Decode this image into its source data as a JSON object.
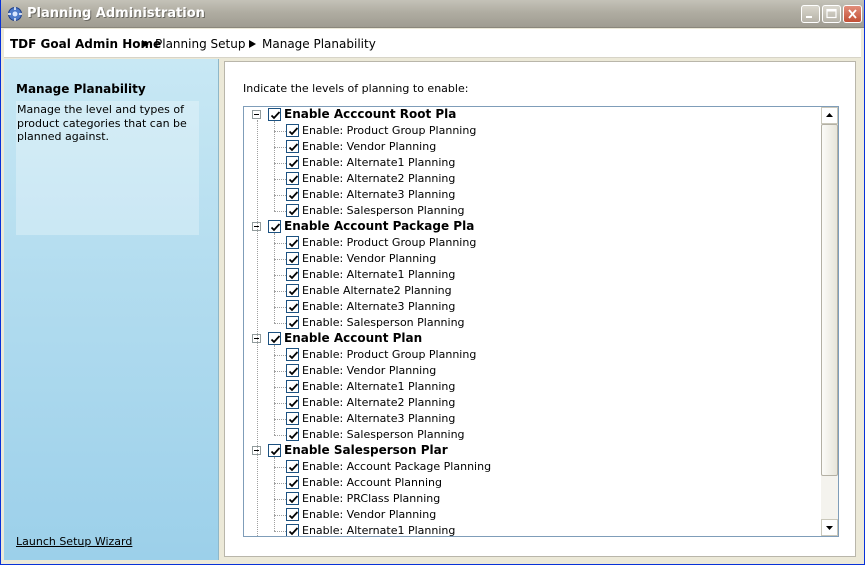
{
  "window": {
    "title": "Planning Administration"
  },
  "breadcrumb": [
    "TDF Goal Admin Home",
    "Planning Setup",
    "Manage Planability"
  ],
  "sidebar": {
    "title": "Manage Planability",
    "description": "Manage the level and types of product categories that can be planned against.",
    "wizard_link": "Launch Setup Wizard"
  },
  "main": {
    "instruction": "Indicate the levels of planning to enable:",
    "groups": [
      {
        "label": "Enable Acccount Root Pla",
        "checked": true,
        "items": [
          {
            "label": "Enable: Product Group Planning",
            "checked": true
          },
          {
            "label": "Enable: Vendor Planning",
            "checked": true
          },
          {
            "label": "Enable: Alternate1 Planning",
            "checked": true
          },
          {
            "label": "Enable: Alternate2 Planning",
            "checked": true
          },
          {
            "label": "Enable: Alternate3 Planning",
            "checked": true
          },
          {
            "label": "Enable: Salesperson Planning",
            "checked": true
          }
        ]
      },
      {
        "label": "Enable Account Package Pla",
        "checked": true,
        "items": [
          {
            "label": "Enable: Product Group Planning",
            "checked": true
          },
          {
            "label": "Enable: Vendor Planning",
            "checked": true
          },
          {
            "label": "Enable: Alternate1 Planning",
            "checked": true
          },
          {
            "label": "Enable Alternate2 Planning",
            "checked": true
          },
          {
            "label": "Enable: Alternate3 Planning",
            "checked": true
          },
          {
            "label": "Enable: Salesperson Planning",
            "checked": true
          }
        ]
      },
      {
        "label": "Enable Account Plan",
        "checked": true,
        "items": [
          {
            "label": "Enable: Product Group Planning",
            "checked": true
          },
          {
            "label": "Enable: Vendor Planning",
            "checked": true
          },
          {
            "label": "Enable: Alternate1 Planning",
            "checked": true
          },
          {
            "label": "Enable: Alternate2 Planning",
            "checked": true
          },
          {
            "label": "Enable: Alternate3 Planning",
            "checked": true
          },
          {
            "label": "Enable: Salesperson Planning",
            "checked": true
          }
        ]
      },
      {
        "label": "Enable Salesperson Plar",
        "checked": true,
        "items": [
          {
            "label": "Enable: Account Package Planning",
            "checked": true
          },
          {
            "label": "Enable: Account Planning",
            "checked": true
          },
          {
            "label": "Enable: PRClass Planning",
            "checked": true
          },
          {
            "label": "Enable: Vendor Planning",
            "checked": true
          },
          {
            "label": "Enable: Alternate1 Planning",
            "checked": true
          }
        ]
      }
    ]
  },
  "icons": {
    "app": "planning-app-icon",
    "minimize": "minimize-icon",
    "maximize": "maximize-icon",
    "close": "close-icon",
    "breadcrumb_separator": "triangle-right-icon",
    "tree_collapse": "minus-box-icon",
    "checkbox": "check-icon",
    "scroll_up": "arrow-up-icon",
    "scroll_down": "arrow-down-icon"
  },
  "colors": {
    "titlebar": "#b0ada2",
    "sidebar": "#b2dcef",
    "tree_border": "#7f9db9",
    "checkbox_border": "#1c5180",
    "check_mark": "#21a121"
  }
}
